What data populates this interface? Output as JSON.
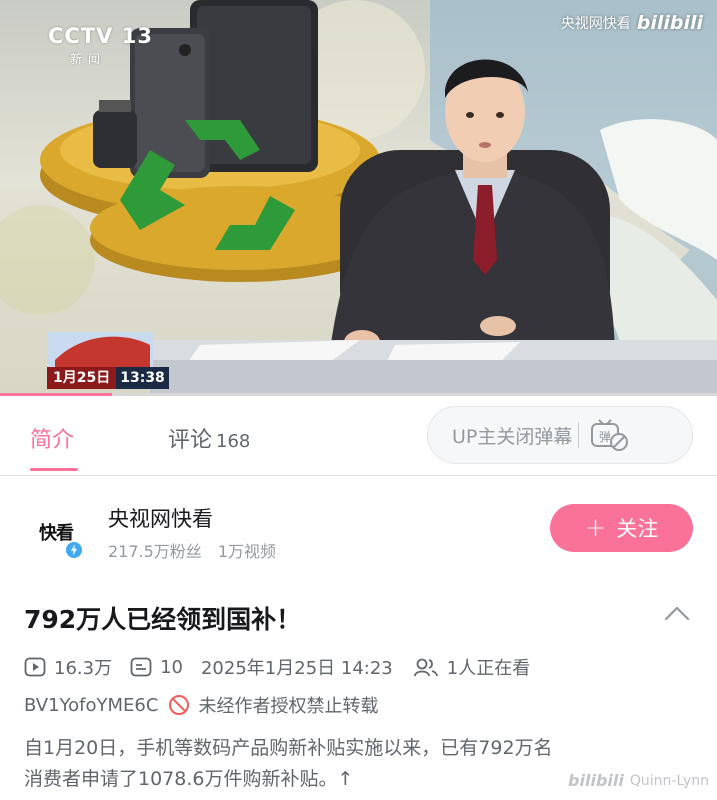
{
  "video": {
    "channel_logo": "CCTV 13",
    "channel_sub": "新闻",
    "watermark_source": "央视网快看",
    "watermark_brand": "bilibili",
    "date_badge": "1月25日",
    "time_badge": "13:38",
    "progress": 0.156
  },
  "tabs": {
    "intro_label": "简介",
    "comments_label": "评论",
    "comments_count": "168",
    "danmaku_label": "UP主关闭弹幕",
    "danmaku_icon": "danmaku-off-icon"
  },
  "uploader": {
    "name": "央视网快看",
    "fans": "217.5万粉丝",
    "videos": "1万视频",
    "follow_label": "关注",
    "avatar_logo": "快看",
    "accent_color": "#fb7299"
  },
  "info": {
    "title": "792万人已经领到国补！",
    "plays": "16.3万",
    "danmaku_count": "10",
    "publish_time": "2025年1月25日 14:23",
    "watching": "1人正在看",
    "bvid": "BV1YofoYME6C",
    "repost_notice": "未经作者授权禁止转载",
    "description_line1": "自1月20日，手机等数码产品购新补贴实施以来，已有792万名",
    "description_line2": "消费者申请了1078.6万件购新补贴。↑"
  },
  "watermark_bottom": {
    "brand": "bilibili",
    "user": "Quinn-Lynn"
  }
}
